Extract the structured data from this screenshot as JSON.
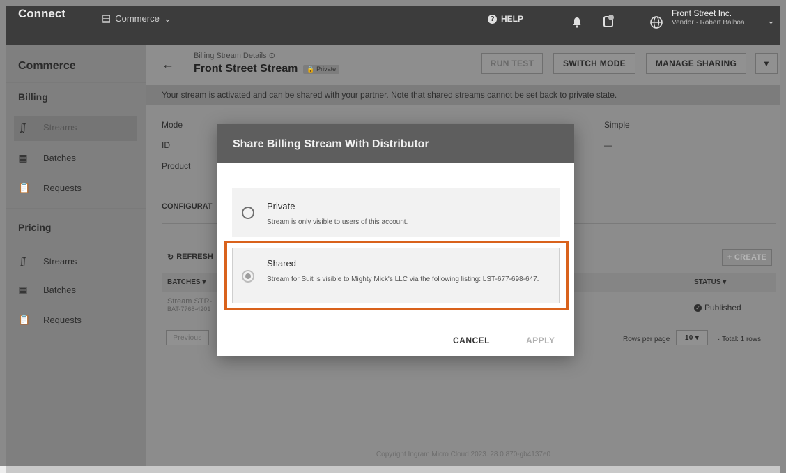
{
  "topbar": {
    "brand": "Connect",
    "module": "Commerce",
    "help": "HELP",
    "account_name": "Front Street Inc.",
    "account_sub": "Vendor · Robert Balboa"
  },
  "sidebar": {
    "title": "Commerce",
    "billing_section": "Billing",
    "billing_items": [
      {
        "label": "Streams",
        "icon": "stream-icon"
      },
      {
        "label": "Batches",
        "icon": "batches-icon"
      },
      {
        "label": "Requests",
        "icon": "requests-icon"
      }
    ],
    "pricing_section": "Pricing",
    "pricing_items": [
      {
        "label": "Streams",
        "icon": "stream-icon"
      },
      {
        "label": "Batches",
        "icon": "batches-icon"
      },
      {
        "label": "Requests",
        "icon": "requests-icon"
      }
    ]
  },
  "header": {
    "breadcrumb": "Billing Stream Details",
    "title": "Front Street Stream",
    "badge": "Private",
    "run_test": "RUN TEST",
    "switch_mode": "SWITCH MODE",
    "manage_sharing": "MANAGE SHARING"
  },
  "banner": "Your stream is activated and can be shared with your partner. Note that shared streams cannot be set back to private state.",
  "details": {
    "mode_label": "Mode",
    "id_label": "ID",
    "product_label": "Product",
    "type_value": "Simple",
    "id_value": "—",
    "config_tab": "CONFIGURAT"
  },
  "table": {
    "refresh": "REFRESH",
    "create": "+ CREATE",
    "col_batches": "BATCHES",
    "col_status": "STATUS",
    "row_name": "Stream STR-",
    "row_id": "BAT-7768-4201",
    "row_status": "Published",
    "previous": "Previous",
    "rows_per_page_label": "Rows per page",
    "rows_per_page": "10",
    "total": "Total: 1 rows"
  },
  "modal": {
    "title": "Share Billing Stream With Distributor",
    "private_title": "Private",
    "private_desc": "Stream is only visible to users of this account.",
    "shared_title": "Shared",
    "shared_desc": "Stream for Suit is visible to Mighty Mick's LLC via the following listing: LST-677-698-647.",
    "cancel": "CANCEL",
    "apply": "APPLY"
  },
  "footer": "Copyright Ingram Micro Cloud 2023. 28.0.870-gb4137e0",
  "colors": {
    "highlight": "#d9621c",
    "modal_header": "#5e5e5e"
  }
}
